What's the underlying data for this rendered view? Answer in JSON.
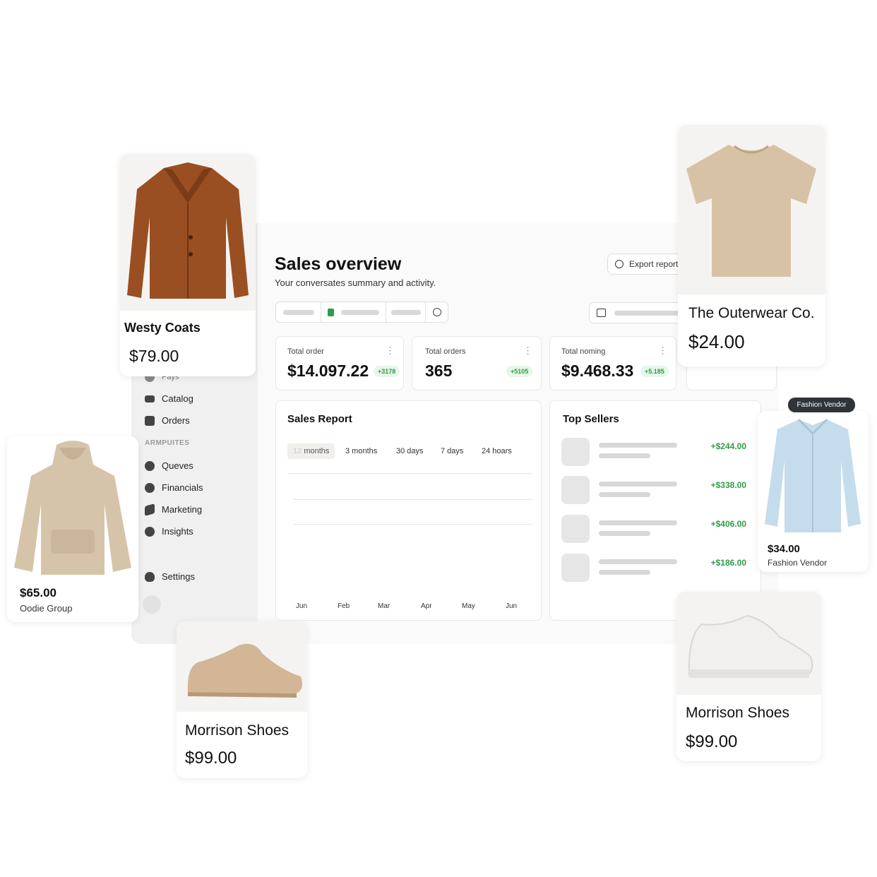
{
  "dashboard": {
    "title": "Sales overview",
    "subtitle": "Your conversates summary and activity.",
    "export_label": "Export report",
    "sidebar": {
      "partial_item": "Pays",
      "items": [
        {
          "label": "Catalog",
          "icon": "catalog-icon"
        },
        {
          "label": "Orders",
          "icon": "orders-icon"
        }
      ],
      "section_label": "ARMPUITES",
      "section_items": [
        {
          "label": "Queves",
          "icon": "check-badge-icon"
        },
        {
          "label": "Financials",
          "icon": "coin-icon"
        },
        {
          "label": "Marketing",
          "icon": "megaphone-icon"
        },
        {
          "label": "Insights",
          "icon": "chart-icon"
        }
      ],
      "settings_label": "Settings"
    },
    "stats": [
      {
        "label": "Total order",
        "value": "$14.097.22",
        "badge": "+3178"
      },
      {
        "label": "Total orders",
        "value": "365",
        "badge": "+5105"
      },
      {
        "label": "Total noming",
        "value": "$9.468.33",
        "badge": "+5.185"
      }
    ],
    "sales_report": {
      "title": "Sales Report",
      "ranges": [
        "months",
        "3 months",
        "30 days",
        "7 days",
        "24 hoars"
      ],
      "active_range_prefix": "12",
      "months": [
        "Jun",
        "Feb",
        "Mar",
        "Apr",
        "May",
        "Jun"
      ]
    },
    "top_sellers": {
      "title": "Top Sellers",
      "amounts": [
        "+$244.00",
        "+$338.00",
        "+$406.00",
        "+$186.00"
      ]
    },
    "accent_color": "#2e9d47"
  },
  "products": [
    {
      "name": "Westy Coats",
      "price": "$79.00"
    },
    {
      "name": "The Outerwear Co.",
      "price": "$24.00"
    },
    {
      "price": "$65.00",
      "vendor": "Oodie Group"
    },
    {
      "price": "$34.00",
      "vendor": "Fashion Vendor",
      "tag": "Fashion Vendor"
    },
    {
      "name": "Morrison Shoes",
      "price": "$99.00"
    },
    {
      "name": "Morrison Shoes",
      "price": "$99.00"
    }
  ]
}
